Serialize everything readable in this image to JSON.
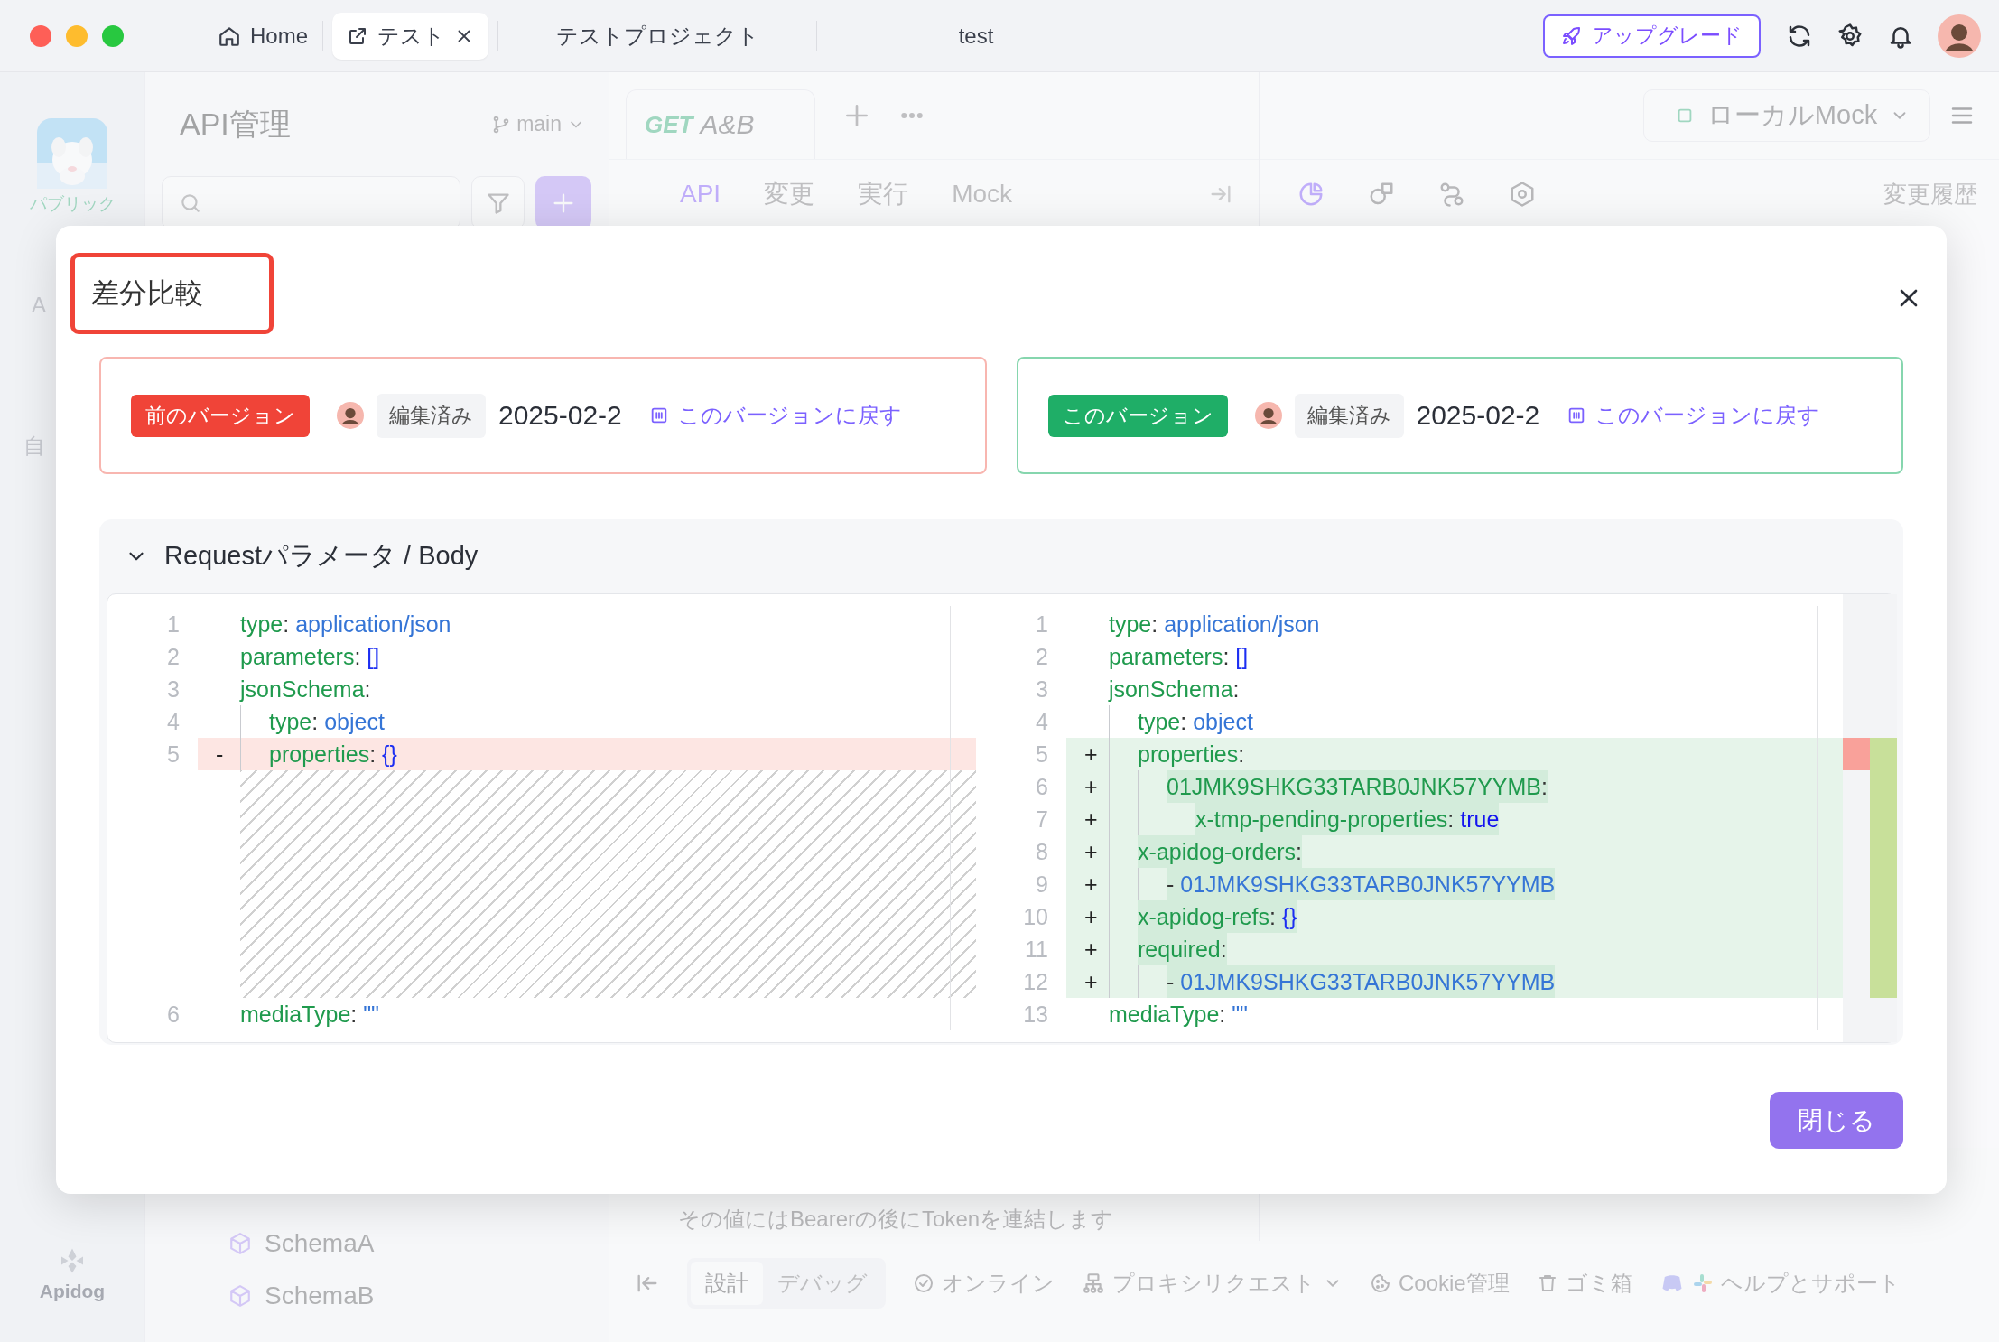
{
  "title_tabs": [
    {
      "kind": "home",
      "label": "Home",
      "selected": false
    },
    {
      "kind": "link",
      "label": "テスト",
      "selected": true
    },
    {
      "kind": "plain",
      "label": "テストプロジェクト",
      "selected": false
    },
    {
      "kind": "plain",
      "label": "test",
      "selected": false
    }
  ],
  "upgrade_button": "アップグレード",
  "rail": {
    "workspace": "パブリック",
    "fragments": [
      "A",
      "自"
    ],
    "brand": "Apidog"
  },
  "sidebar": {
    "title": "API管理",
    "branch": "main",
    "schemas": [
      "SchemaA",
      "SchemaB"
    ]
  },
  "editor": {
    "tab": {
      "method": "GET",
      "name": "A&B"
    },
    "subtabs": [
      {
        "label": "API",
        "selected": true
      },
      {
        "label": "変更",
        "selected": false
      },
      {
        "label": "実行",
        "selected": false
      },
      {
        "label": "Mock",
        "selected": false
      }
    ],
    "hint": "その値にはBearerの後にTokenを連結します"
  },
  "inspector": {
    "environment": "ローカルMock",
    "tools": [
      {
        "kind": "doc",
        "selected": true
      },
      {
        "kind": "shapes",
        "selected": false
      },
      {
        "kind": "flow",
        "selected": false
      },
      {
        "kind": "settings",
        "selected": false
      }
    ],
    "history": "変更履歴"
  },
  "status_bar": {
    "modes": [
      {
        "label": "設計",
        "selected": true
      },
      {
        "label": "デバッグ",
        "selected": false
      }
    ],
    "items": [
      {
        "kind": "online",
        "label": "オンライン"
      },
      {
        "kind": "proxy",
        "label": "プロキシリクエスト"
      },
      {
        "kind": "cookie",
        "label": "Cookie管理"
      },
      {
        "kind": "trash",
        "label": "ゴミ箱"
      },
      {
        "kind": "help",
        "label": "ヘルプとサポート"
      }
    ]
  },
  "dialog": {
    "title": "差分比較",
    "title_highlighted": true,
    "versions": [
      {
        "current": false,
        "badge": "前のバージョン",
        "status": "編集済み",
        "date": "2025-02-2",
        "revert": "このバージョンに戻す"
      },
      {
        "current": true,
        "badge": "このバージョン",
        "status": "編集済み",
        "date": "2025-02-2",
        "revert": "このバージョンに戻す"
      }
    ],
    "section": {
      "title": "Requestパラメータ / Body",
      "expanded": true
    },
    "diff": {
      "left": [
        {
          "kind": "line",
          "no": "1",
          "removed": false,
          "tokens": [
            {
              "kind": "key",
              "text": "type"
            },
            {
              "kind": "punct",
              "text": ": "
            },
            {
              "kind": "string",
              "text": "application/json"
            }
          ]
        },
        {
          "kind": "line",
          "no": "2",
          "removed": false,
          "tokens": [
            {
              "kind": "key",
              "text": "parameters"
            },
            {
              "kind": "punct",
              "text": ": "
            },
            {
              "kind": "bracket",
              "text": "[]"
            }
          ]
        },
        {
          "kind": "line",
          "no": "3",
          "removed": false,
          "tokens": [
            {
              "kind": "key",
              "text": "jsonSchema"
            },
            {
              "kind": "punct",
              "text": ":"
            }
          ],
          "children": [
            {
              "kind": "line",
              "no": "4",
              "removed": false,
              "tokens": [
                {
                  "kind": "key",
                  "text": "type"
                },
                {
                  "kind": "punct",
                  "text": ": "
                },
                {
                  "kind": "string",
                  "text": "object"
                }
              ]
            },
            {
              "kind": "line",
              "no": "5",
              "removed": true,
              "sign": "-",
              "tokens": [
                {
                  "kind": "key",
                  "text": "properties"
                },
                {
                  "kind": "punct",
                  "text": ": "
                },
                {
                  "kind": "bracket",
                  "text": "{}"
                }
              ]
            }
          ]
        },
        {
          "kind": "filler"
        },
        {
          "kind": "line",
          "no": "6",
          "removed": false,
          "tokens": [
            {
              "kind": "key",
              "text": "mediaType"
            },
            {
              "kind": "punct",
              "text": ": "
            },
            {
              "kind": "string",
              "text": "\"\""
            }
          ]
        }
      ],
      "right": [
        {
          "kind": "line",
          "no": "1",
          "added": false,
          "tokens": [
            {
              "kind": "key",
              "text": "type"
            },
            {
              "kind": "punct",
              "text": ": "
            },
            {
              "kind": "string",
              "text": "application/json"
            }
          ]
        },
        {
          "kind": "line",
          "no": "2",
          "added": false,
          "tokens": [
            {
              "kind": "key",
              "text": "parameters"
            },
            {
              "kind": "punct",
              "text": ": "
            },
            {
              "kind": "bracket",
              "text": "[]"
            }
          ]
        },
        {
          "kind": "line",
          "no": "3",
          "added": false,
          "tokens": [
            {
              "kind": "key",
              "text": "jsonSchema"
            },
            {
              "kind": "punct",
              "text": ":"
            }
          ],
          "children": [
            {
              "kind": "line",
              "no": "4",
              "added": false,
              "tokens": [
                {
                  "kind": "key",
                  "text": "type"
                },
                {
                  "kind": "punct",
                  "text": ": "
                },
                {
                  "kind": "string",
                  "text": "object"
                }
              ]
            },
            {
              "kind": "line",
              "no": "5",
              "added": true,
              "sign": "+",
              "highlight": false,
              "tokens": [
                {
                  "kind": "key",
                  "text": "properties"
                },
                {
                  "kind": "punct",
                  "text": ":"
                }
              ],
              "children": [
                {
                  "kind": "line",
                  "no": "6",
                  "added": true,
                  "sign": "+",
                  "highlight": true,
                  "tokens": [
                    {
                      "kind": "key",
                      "text": "01JMK9SHKG33TARB0JNK57YYMB"
                    },
                    {
                      "kind": "punct",
                      "text": ":"
                    }
                  ],
                  "children": [
                    {
                      "kind": "line",
                      "no": "7",
                      "added": true,
                      "sign": "+",
                      "highlight": true,
                      "tokens": [
                        {
                          "kind": "key",
                          "text": "x-tmp-pending-properties"
                        },
                        {
                          "kind": "punct",
                          "text": ": "
                        },
                        {
                          "kind": "literal",
                          "text": "true"
                        }
                      ]
                    }
                  ]
                }
              ]
            },
            {
              "kind": "line",
              "no": "8",
              "added": true,
              "sign": "+",
              "highlight": true,
              "tokens": [
                {
                  "kind": "key",
                  "text": "x-apidog-orders"
                },
                {
                  "kind": "punct",
                  "text": ":"
                }
              ],
              "children": [
                {
                  "kind": "line",
                  "no": "9",
                  "added": true,
                  "sign": "+",
                  "highlight": true,
                  "tokens": [
                    {
                      "kind": "punct",
                      "text": "- "
                    },
                    {
                      "kind": "string",
                      "text": "01JMK9SHKG33TARB0JNK57YYMB"
                    }
                  ]
                }
              ]
            },
            {
              "kind": "line",
              "no": "10",
              "added": true,
              "sign": "+",
              "highlight": true,
              "tokens": [
                {
                  "kind": "key",
                  "text": "x-apidog-refs"
                },
                {
                  "kind": "punct",
                  "text": ": "
                },
                {
                  "kind": "bracket",
                  "text": "{}"
                }
              ]
            },
            {
              "kind": "line",
              "no": "11",
              "added": true,
              "sign": "+",
              "highlight": true,
              "tokens": [
                {
                  "kind": "key",
                  "text": "required"
                },
                {
                  "kind": "punct",
                  "text": ":"
                }
              ],
              "children": [
                {
                  "kind": "line",
                  "no": "12",
                  "added": true,
                  "sign": "+",
                  "highlight": true,
                  "tokens": [
                    {
                      "kind": "punct",
                      "text": "- "
                    },
                    {
                      "kind": "string",
                      "text": "01JMK9SHKG33TARB0JNK57YYMB"
                    }
                  ]
                }
              ]
            }
          ]
        },
        {
          "kind": "line",
          "no": "13",
          "added": false,
          "tokens": [
            {
              "kind": "key",
              "text": "mediaType"
            },
            {
              "kind": "punct",
              "text": ": "
            },
            {
              "kind": "string",
              "text": "\"\""
            }
          ]
        }
      ]
    },
    "close_button": "閉じる"
  }
}
